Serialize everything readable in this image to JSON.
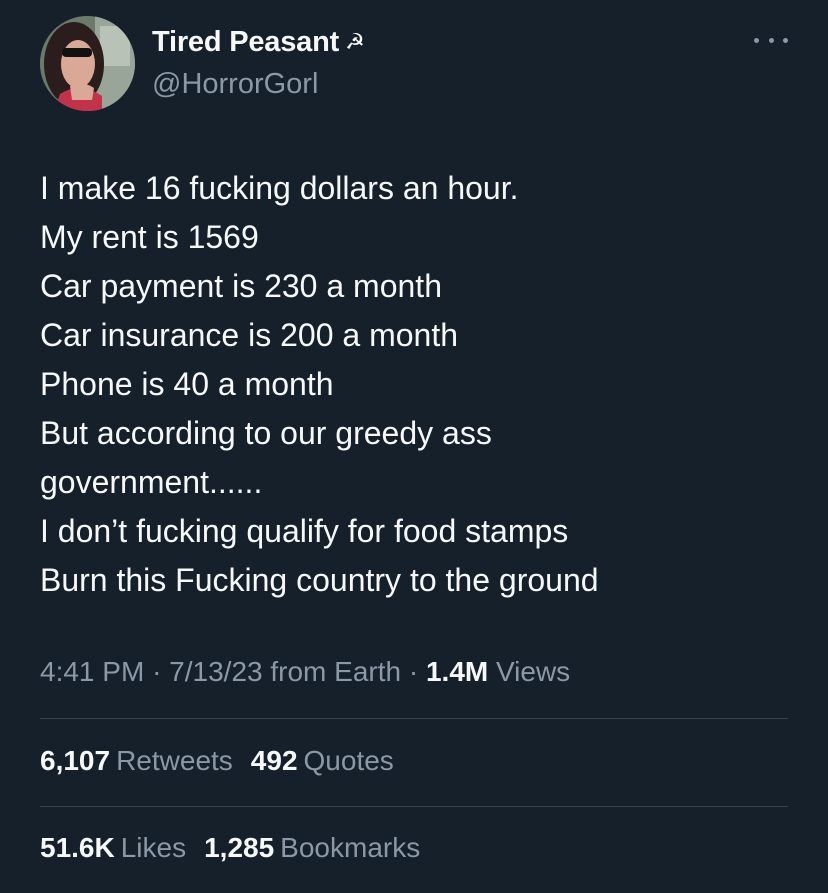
{
  "author": {
    "display_name": "Tired Peasant",
    "name_emoji": "☭",
    "handle": "@HorrorGorl",
    "avatar_icon": "profile-photo"
  },
  "menu": {
    "icon": "more-horizontal-icon"
  },
  "tweet": {
    "lines": [
      "I make 16 fucking dollars an hour.",
      "My rent is 1569",
      "Car payment is 230 a month",
      "Car insurance is 200 a month",
      "Phone is 40 a month",
      "But according to our greedy ass",
      "government......",
      "I don’t fucking qualify for food stamps",
      "Burn this Fucking country to the ground"
    ]
  },
  "meta": {
    "time": "4:41 PM",
    "date": "7/13/23",
    "source": "from Earth",
    "views_count": "1.4M",
    "views_label": "Views"
  },
  "stats": {
    "retweets": {
      "count": "6,107",
      "label": "Retweets"
    },
    "quotes": {
      "count": "492",
      "label": "Quotes"
    },
    "likes": {
      "count": "51.6K",
      "label": "Likes"
    },
    "bookmarks": {
      "count": "1,285",
      "label": "Bookmarks"
    }
  },
  "colors": {
    "background": "#15202b",
    "primary_text": "#f7f9f9",
    "secondary_text": "#8b98a5",
    "divider": "#38444d"
  }
}
